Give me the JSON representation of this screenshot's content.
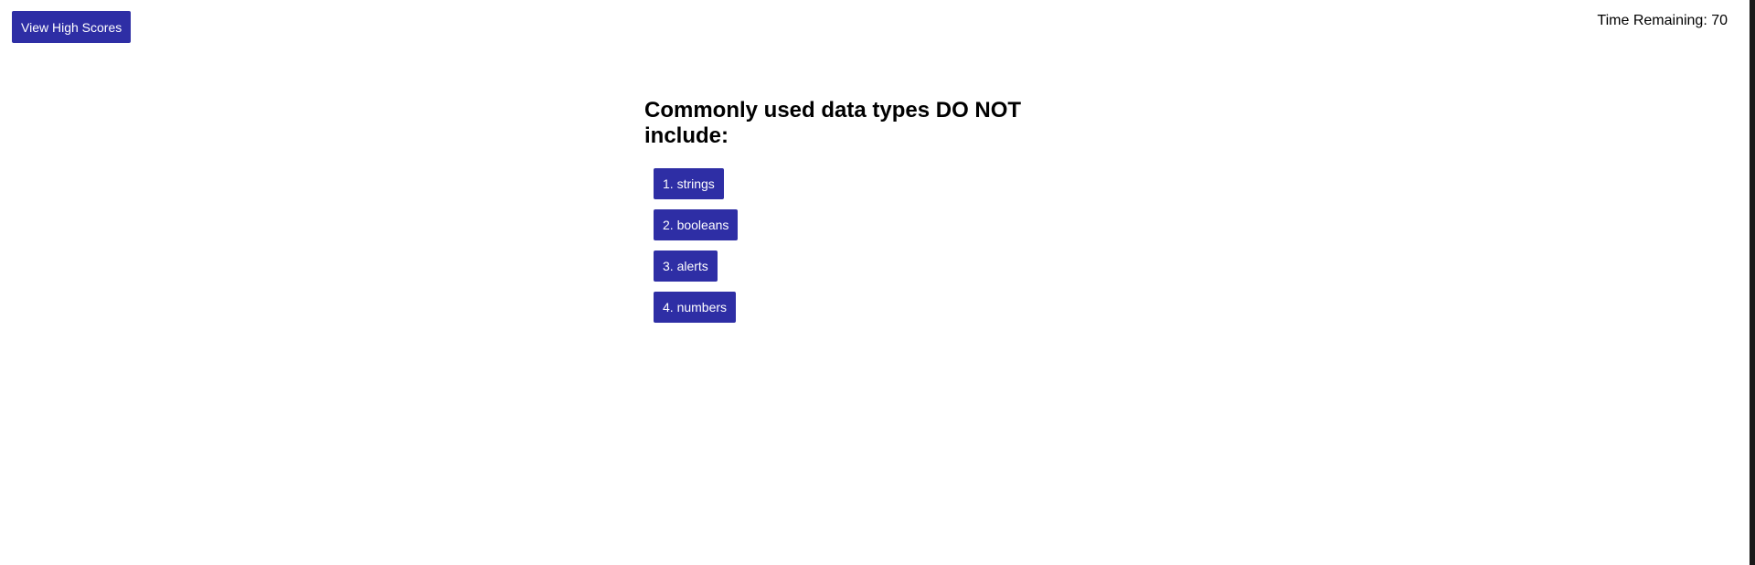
{
  "header": {
    "high_scores_label": "View High Scores",
    "timer_text": "Time Remaining: 70"
  },
  "quiz": {
    "question": "Commonly used data types DO NOT include:",
    "choices": [
      {
        "label": "1. strings"
      },
      {
        "label": "2. booleans"
      },
      {
        "label": "3. alerts"
      },
      {
        "label": "4. numbers"
      }
    ]
  },
  "colors": {
    "button_bg": "#2e2ea5",
    "button_text": "#ffffff",
    "page_bg": "#ffffff"
  }
}
